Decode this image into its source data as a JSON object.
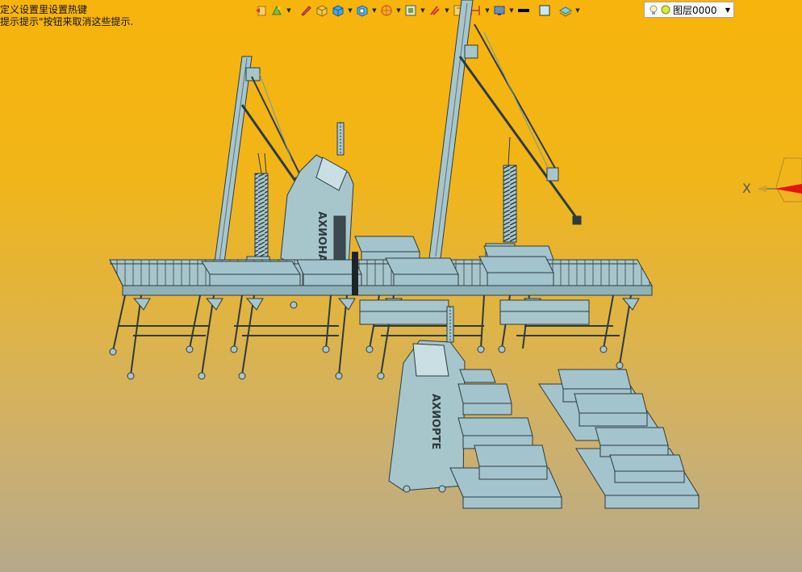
{
  "hint": {
    "line1": "定义设置里设置热键",
    "line2": "提示提示\"按钮来取消这些提示."
  },
  "toolbar": {
    "layer_name": "图层0000",
    "icons": [
      "undo-icon",
      "paint-icon",
      "pen-icon",
      "box-yellow-icon",
      "box-blue-icon",
      "view-icon",
      "sphere-icon",
      "frame-icon",
      "paint2-icon",
      "ruler-icon",
      "measure-icon",
      "display-icon",
      "linestyle-icon",
      "color-icon",
      "layers-icon"
    ]
  },
  "viewport": {
    "axis_x_label": "X",
    "machine_label_1": "АХИОНА",
    "machine_label_2": "АХИОРТЕ"
  },
  "colors": {
    "steel": "#a6c6cc",
    "steel_dark": "#4a5b60",
    "box": "#a3c4cc",
    "axis_red": "#e21414"
  }
}
